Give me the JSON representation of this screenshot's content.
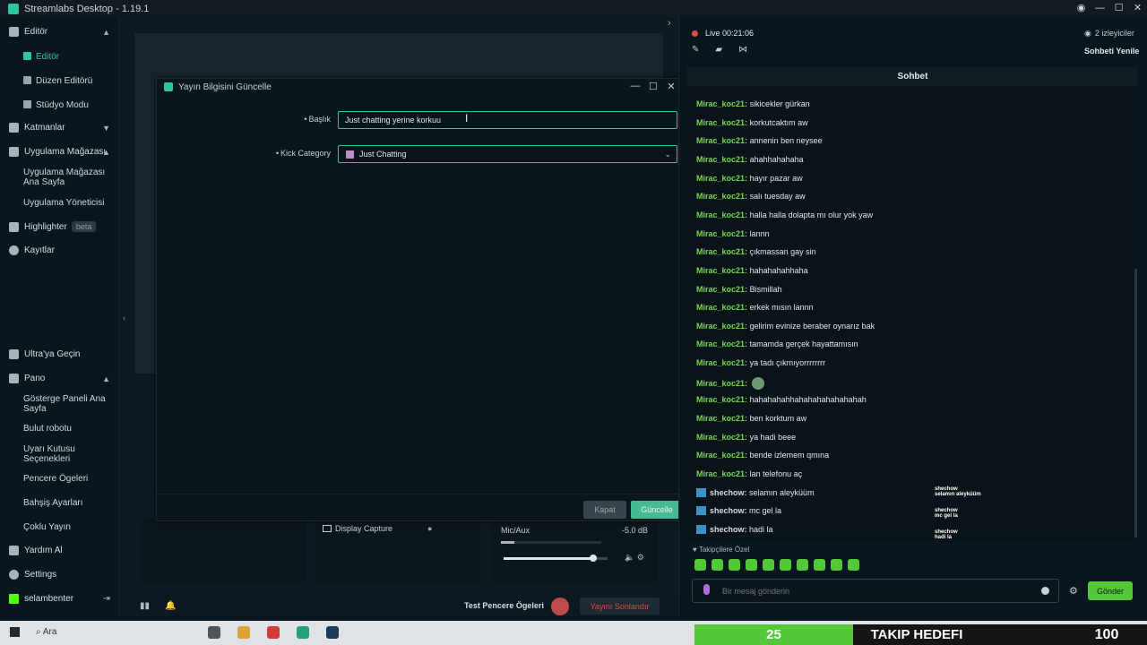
{
  "window": {
    "title": "Streamlabs Desktop - 1.19.1"
  },
  "nav": {
    "editor": "Editör",
    "editor_sub": [
      "Editör",
      "Düzen Editörü",
      "Stüdyo Modu"
    ],
    "layers": "Katmanlar",
    "app_store": "Uygulama Mağazası",
    "app_store_sub": [
      "Uygulama Mağazası Ana Sayfa",
      "Uygulama Yöneticisi"
    ],
    "highlighter": "Highlighter",
    "highlighter_badge": "beta",
    "recordings": "Kayıtlar",
    "ultra": "Ultra'ya Geçin",
    "dashboard": "Pano",
    "dashboard_sub": [
      "Gösterge Paneli Ana Sayfa",
      "Bulut robotu",
      "Uyarı Kutusu Seçenekleri",
      "Pencere Ögeleri",
      "Bahşiş Ayarları",
      "Çoklu Yayın"
    ],
    "help": "Yardım Al",
    "settings": "Settings",
    "username": "selambenter"
  },
  "dialog": {
    "title": "Yayın Bilgisini Güncelle",
    "title_label": "Başlık",
    "title_value": "Just chatting yerine korkuu",
    "category_label": "Kick Category",
    "category_value": "Just Chatting",
    "cancel": "Kapat",
    "update": "Güncelle"
  },
  "editor": {
    "source_name": "Display Capture",
    "mixer_name": "Mic/Aux",
    "mixer_db": "-5.0 dB",
    "mixer_level": 0.13,
    "mixer_volume": 0.86,
    "test_widgets": "Test Pencere Ögeleri",
    "end_stream": "Yayını Sonlandır"
  },
  "chat": {
    "live_label": "Live",
    "live_time": "00:21:06",
    "viewers": "2 izleyiciler",
    "refresh": "Sohbeti Yenile",
    "header": "Sohbet",
    "messages": [
      {
        "user": "Mirac_koc21:",
        "text": "sikicekler gürkan"
      },
      {
        "user": "Mirac_koc21:",
        "text": "korkutcaktım aw"
      },
      {
        "user": "Mirac_koc21:",
        "text": "annenin ben neysee"
      },
      {
        "user": "Mirac_koc21:",
        "text": "ahahhahahaha"
      },
      {
        "user": "Mirac_koc21:",
        "text": "hayır pazar aw"
      },
      {
        "user": "Mirac_koc21:",
        "text": "salı tuesday aw"
      },
      {
        "user": "Mirac_koc21:",
        "text": "halla halla dolapta mı olur yok yaw"
      },
      {
        "user": "Mirac_koc21:",
        "text": "lannn"
      },
      {
        "user": "Mirac_koc21:",
        "text": "çıkmassan gay sin"
      },
      {
        "user": "Mirac_koc21:",
        "text": "hahahahahhaha"
      },
      {
        "user": "Mirac_koc21:",
        "text": "Bismillah"
      },
      {
        "user": "Mirac_koc21:",
        "text": "erkek mısın lannn"
      },
      {
        "user": "Mirac_koc21:",
        "text": "gelirim evinize beraber oynarız bak"
      },
      {
        "user": "Mirac_koc21:",
        "text": "tamamda gerçek hayattamısın"
      },
      {
        "user": "Mirac_koc21:",
        "text": "ya tadı çıkmıyorrrrrrrr"
      },
      {
        "user": "Mirac_koc21:",
        "text": ""
      },
      {
        "user": "Mirac_koc21:",
        "text": "hahahahahhahahahahahahahah"
      },
      {
        "user": "Mirac_koc21:",
        "text": "ben korktum aw"
      },
      {
        "user": "Mirac_koc21:",
        "text": "ya hadi beee"
      },
      {
        "user": "Mirac_koc21:",
        "text": "bende izlemem qmına"
      },
      {
        "user": "Mirac_koc21:",
        "text": "lan telefonu aç"
      },
      {
        "user": "shechow:",
        "text": "selamın aleyküüm"
      },
      {
        "user": "shechow:",
        "text": "mc gel la"
      },
      {
        "user": "shechow:",
        "text": "hadi la"
      }
    ],
    "overlay": [
      {
        "user": "shechow",
        "text": "selamın aleyküüm"
      },
      {
        "user": "shechow",
        "text": "mc gel la"
      },
      {
        "user": "shechow",
        "text": "hadi la"
      }
    ],
    "followers_only": "Takipçilere Özel",
    "input_placeholder": "Bir mesaj gönderin",
    "send": "Gönder"
  },
  "taskbar": {
    "search": "Ara",
    "goal_current": "25",
    "goal_label": "TAKIP HEDEFI",
    "goal_target": "100"
  },
  "colors": {
    "accent": "#31c3a2",
    "kick_green": "#53c93a",
    "chat_user": "#74d94c",
    "live_red": "#e54848"
  }
}
